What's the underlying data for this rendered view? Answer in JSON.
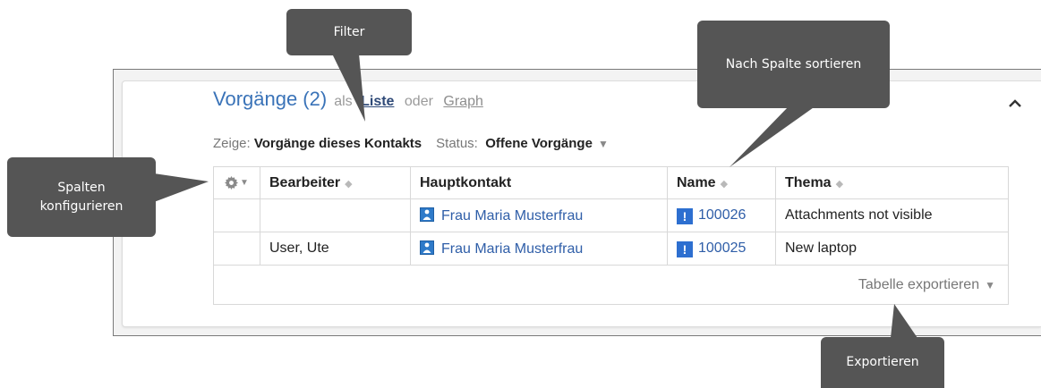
{
  "panel": {
    "title": "Vorgänge (2)",
    "view_as_prefix": "als",
    "view_list": "Liste",
    "view_or": "oder",
    "view_graph": "Graph"
  },
  "filters": {
    "show_label": "Zeige:",
    "show_value": "Vorgänge dieses Kontakts",
    "status_label": "Status:",
    "status_value": "Offene Vorgänge"
  },
  "table": {
    "columns": [
      "Bearbeiter",
      "Hauptkontakt",
      "Name",
      "Thema"
    ],
    "rows": [
      {
        "bearbeiter": "",
        "hauptkontakt": "Frau Maria Musterfrau",
        "name": "100026",
        "thema": "Attachments not visible"
      },
      {
        "bearbeiter": "User, Ute",
        "hauptkontakt": "Frau Maria Musterfrau",
        "name": "100025",
        "thema": "New laptop"
      }
    ],
    "export_label": "Tabelle exportieren"
  },
  "callouts": {
    "filter": "Filter",
    "sort": "Nach Spalte sortieren",
    "columns": "Spalten konfigurieren",
    "export": "Exportieren"
  },
  "icons": {
    "collapse": "chevron-up-icon",
    "gear": "gear-icon",
    "sort": "sort-icon",
    "contact": "contact-icon",
    "issue": "issue-icon"
  },
  "colors": {
    "title": "#3a73b8",
    "link": "#2f5ea8",
    "callout": "#555555",
    "issue_icon": "#2d6fd0"
  }
}
